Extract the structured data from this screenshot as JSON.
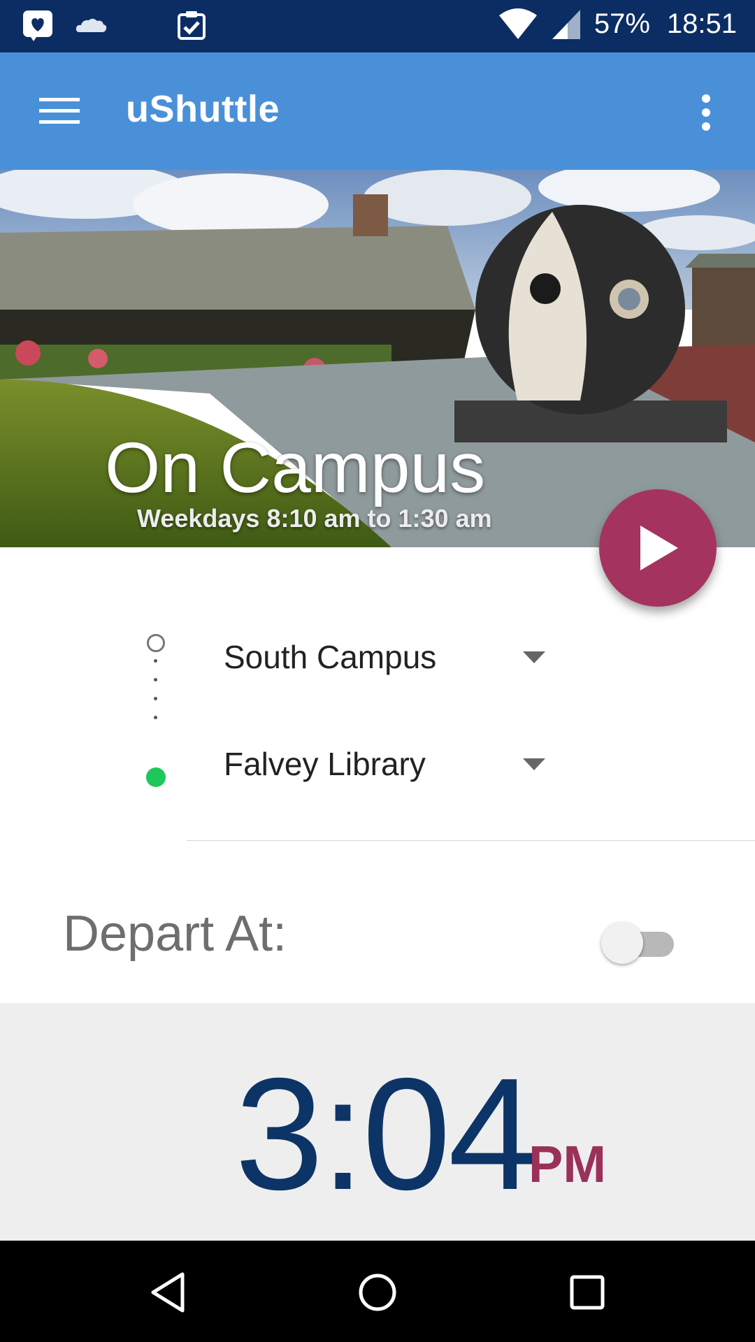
{
  "status_bar": {
    "battery": "57%",
    "time": "18:51",
    "left_icons": [
      "heart-message-icon",
      "cloud-icon",
      "clipboard-check-icon"
    ],
    "right_icons": [
      "wifi-icon",
      "cell-signal-icon"
    ]
  },
  "app_bar": {
    "title": "uShuttle",
    "menu_icon": "hamburger-menu-icon",
    "overflow_icon": "more-vert-icon"
  },
  "hero": {
    "title": "On Campus",
    "subtitle": "Weekdays 8:10 am to 1:30 am"
  },
  "fab": {
    "icon": "play-icon",
    "color": "#a4335f"
  },
  "route": {
    "origin": "South Campus",
    "destination": "Falvey Library",
    "destination_dot_color": "#1ec75a"
  },
  "depart": {
    "label": "Depart At:",
    "toggle_on": false
  },
  "time": {
    "value": "3:04",
    "ampm": "PM"
  },
  "colors": {
    "status_bar": "#0b2d63",
    "app_bar": "#4a90d9",
    "accent": "#a4335f",
    "time_text": "#0d3466"
  },
  "nav_bar": {
    "icons": [
      "back-icon",
      "home-icon",
      "recents-icon"
    ]
  }
}
